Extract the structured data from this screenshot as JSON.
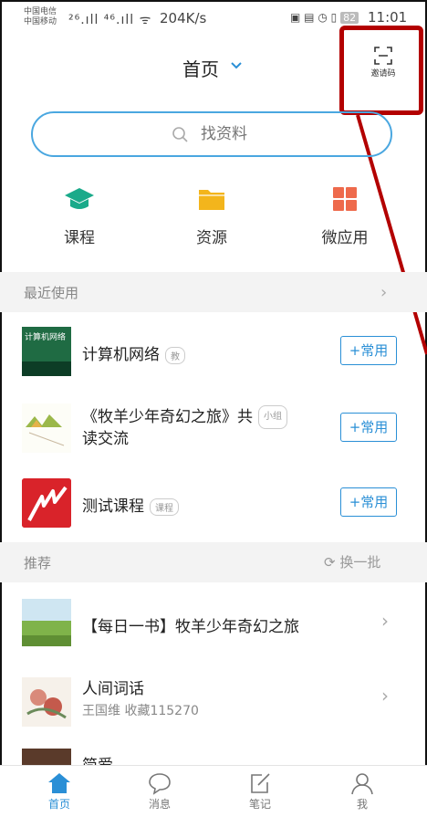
{
  "status_bar": {
    "carrier_1": "中国电信",
    "carrier_2": "中国移动",
    "signal_text": "²⁶.ıll ⁴⁶.ıll ",
    "network_speed": "204K/s",
    "battery": "82",
    "time": "11:01"
  },
  "header": {
    "title": "首页",
    "invite_label": "邀请码"
  },
  "search": {
    "placeholder": "找资料"
  },
  "quick_actions": [
    {
      "label": "课程",
      "icon": "graduation-cap-icon",
      "color": "#1aaa8a"
    },
    {
      "label": "资源",
      "icon": "folder-icon",
      "color": "#f3b51c"
    },
    {
      "label": "微应用",
      "icon": "grid-apps-icon",
      "color": "#ee6a4c"
    }
  ],
  "recent": {
    "title": "最近使用",
    "items": [
      {
        "title": "计算机网络",
        "tag": "教",
        "button": "+常用",
        "thumb_text": "计算机网络"
      },
      {
        "title_line1": "《牧羊少年奇幻之旅》共",
        "title_line2": "读交流",
        "tag": "小组",
        "button": "+常用"
      },
      {
        "title": "测试课程",
        "tag": "课程",
        "button": "+常用"
      }
    ]
  },
  "recommend": {
    "title": "推荐",
    "refresh_label": "换一批",
    "items": [
      {
        "title": "【每日一书】牧羊少年奇幻之旅"
      },
      {
        "title": "人间词话",
        "subtitle": "王国维 收藏115270"
      },
      {
        "title": "简爱"
      }
    ]
  },
  "bottom_nav": [
    {
      "label": "首页",
      "icon": "home-icon",
      "active": true
    },
    {
      "label": "消息",
      "icon": "chat-bubble-icon",
      "active": false
    },
    {
      "label": "笔记",
      "icon": "note-edit-icon",
      "active": false
    },
    {
      "label": "我",
      "icon": "person-icon",
      "active": false
    }
  ],
  "colors": {
    "accent": "#2a8fd6",
    "search_border": "#4aa7e0",
    "annotation_red": "#b30000"
  }
}
